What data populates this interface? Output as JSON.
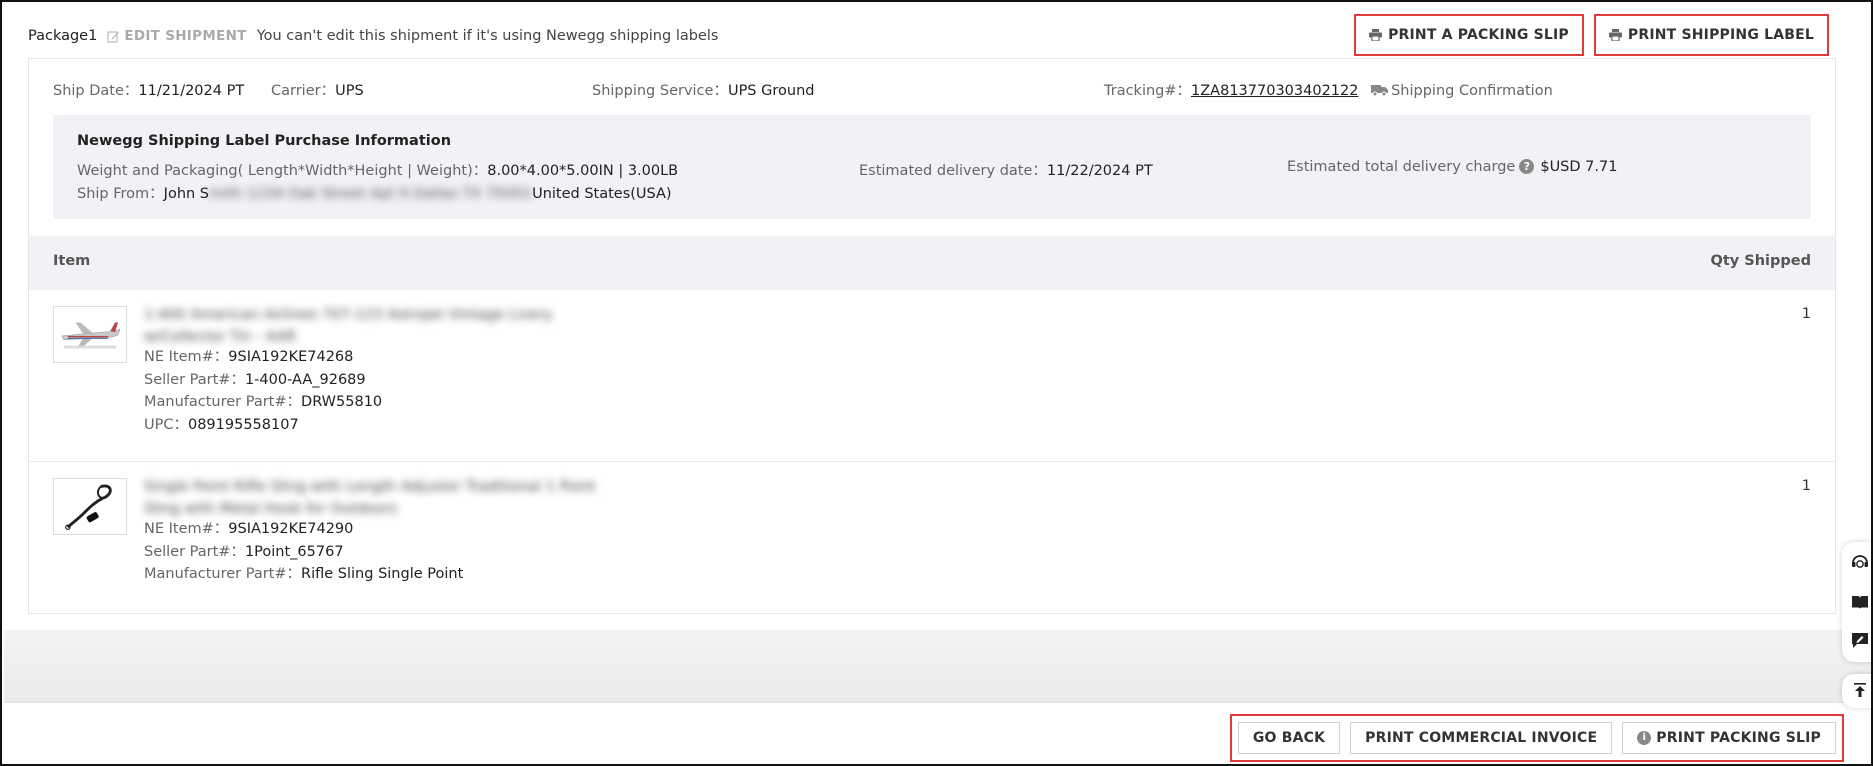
{
  "header": {
    "package_name": "Package1",
    "edit_label": "EDIT SHIPMENT",
    "edit_note": "You can't edit this shipment if it's using Newegg shipping labels",
    "print_packing_slip_label": "PRINT A PACKING SLIP",
    "print_shipping_label_label": "PRINT SHIPPING LABEL"
  },
  "shipment": {
    "ship_date_label": "Ship Date：",
    "ship_date": "11/21/2024 PT",
    "carrier_label": "Carrier：",
    "carrier": "UPS",
    "service_label": "Shipping Service：",
    "service": "UPS Ground",
    "tracking_label": "Tracking#：",
    "tracking_number": "1ZA813770303402122",
    "confirmation_label": "Shipping Confirmation"
  },
  "purchase_info": {
    "title": "Newegg Shipping Label Purchase Information",
    "weight_label": "Weight and Packaging( Length*Width*Height | Weight)：",
    "weight_value": "8.00*4.00*5.00IN | 3.00LB",
    "delivery_date_label": "Estimated delivery date：",
    "delivery_date": "11/22/2024 PT",
    "charge_label": "Estimated total delivery charge",
    "charge_value": "$USD 7.71",
    "ship_from_label": "Ship From：",
    "ship_from_name": "John S",
    "ship_from_country": "United States(USA)"
  },
  "items_table": {
    "col_item": "Item",
    "col_qty": "Qty Shipped",
    "rows": [
      {
        "title_line1": "1:400 American Airlines 707-123 Astrojet Vintage Livery",
        "title_line2": "w/Collector Tin - AAR",
        "ne_item_label": "NE Item#：",
        "ne_item": "9SIA192KE74268",
        "seller_part_label": "Seller Part#：",
        "seller_part": "1-400-AA_92689",
        "mfr_part_label": "Manufacturer Part#：",
        "mfr_part": "DRW55810",
        "upc_label": "UPC：",
        "upc": "089195558107",
        "qty": "1"
      },
      {
        "title_line1": "Single Point Rifle Sling with Length Adjuster Traditional 1 Point",
        "title_line2": "Sling with Metal Hook for Outdoors",
        "ne_item_label": "NE Item#：",
        "ne_item": "9SIA192KE74290",
        "seller_part_label": "Seller Part#：",
        "seller_part": "1Point_65767",
        "mfr_part_label": "Manufacturer Part#：",
        "mfr_part": "Rifle Sling Single Point",
        "qty": "1"
      }
    ]
  },
  "footer": {
    "go_back_label": "GO BACK",
    "commercial_invoice_label": "PRINT COMMERCIAL INVOICE",
    "packing_slip_label": "PRINT PACKING SLIP"
  },
  "icons": {
    "edit": "edit-icon",
    "printer": "printer-icon",
    "truck": "truck-icon",
    "help": "help-icon",
    "info": "info-icon",
    "support": "support-icon",
    "book": "book-icon",
    "feedback": "feedback-icon",
    "scroll_top": "scroll-top-icon"
  },
  "colors": {
    "highlight_border": "#e03a3a",
    "panel_bg": "#f1f2f6",
    "text": "#333333"
  }
}
